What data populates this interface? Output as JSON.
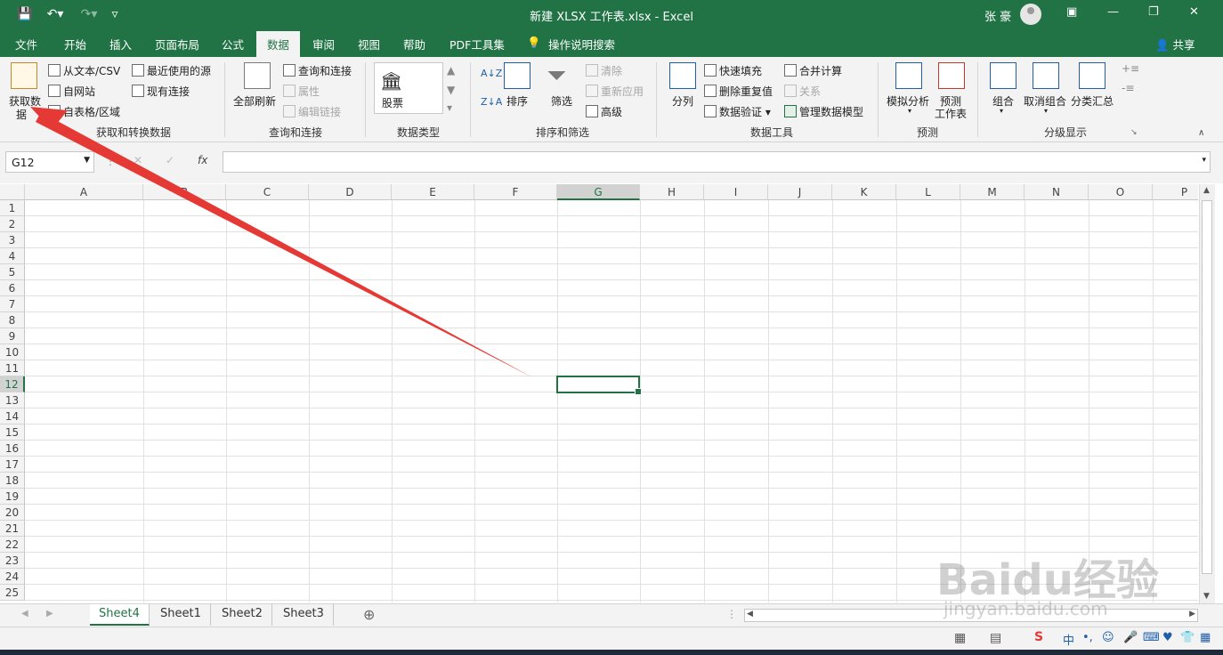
{
  "title": "新建 XLSX 工作表.xlsx  -  Excel",
  "user": "张 豪",
  "qat": {
    "save": "save-icon",
    "undo": "undo-icon",
    "redo": "redo-icon",
    "customize": "customize-icon"
  },
  "window": {
    "restore": "ribbon-display-icon",
    "minimize": "minimize-icon",
    "maximize": "maximize-icon",
    "close": "close-icon"
  },
  "tabs": [
    "文件",
    "开始",
    "插入",
    "页面布局",
    "公式",
    "数据",
    "审阅",
    "视图",
    "帮助",
    "PDF工具集",
    "操作说明搜索"
  ],
  "active_tab": "数据",
  "share": "共享",
  "ribbon": {
    "get_data": {
      "big": "获取数",
      "big2": "据",
      "from_text": "从文本/CSV",
      "from_web": "自网站",
      "from_table": "自表格/区域",
      "recent": "最近使用的源",
      "existing": "现有连接",
      "label": "获取和转换数据"
    },
    "queries": {
      "refresh": "全部刷新",
      "queries_conn": "查询和连接",
      "properties": "属性",
      "edit_links": "编辑链接",
      "label": "查询和连接"
    },
    "data_types": {
      "stock": "股票",
      "label": "数据类型"
    },
    "sort_filter": {
      "sort": "排序",
      "filter": "筛选",
      "clear": "清除",
      "reapply": "重新应用",
      "advanced": "高级",
      "label": "排序和筛选"
    },
    "data_tools": {
      "text_to_cols": "分列",
      "flash_fill": "快速填充",
      "remove_dup": "删除重复值",
      "validation": "数据验证",
      "consolidate": "合并计算",
      "relationships": "关系",
      "manage_model": "管理数据模型",
      "label": "数据工具"
    },
    "forecast": {
      "what_if": "模拟分析",
      "forecast_sheet": "预测",
      "forecast_sheet2": "工作表",
      "label": "预测"
    },
    "outline": {
      "group": "组合",
      "ungroup": "取消组合",
      "subtotal": "分类汇总",
      "label": "分级显示"
    }
  },
  "name_box": "G12",
  "fx": "fx",
  "columns": [
    "A",
    "B",
    "C",
    "D",
    "E",
    "F",
    "G",
    "H",
    "I",
    "J",
    "K",
    "L",
    "M",
    "N",
    "O",
    "P"
  ],
  "rows": [
    "1",
    "2",
    "3",
    "4",
    "5",
    "6",
    "7",
    "8",
    "9",
    "10",
    "11",
    "12",
    "13",
    "14",
    "15",
    "16",
    "17",
    "18",
    "19",
    "20",
    "21",
    "22",
    "23",
    "24",
    "25"
  ],
  "selected_cell": {
    "col": "G",
    "row": "12"
  },
  "sheets": [
    "Sheet4",
    "Sheet1",
    "Sheet2",
    "Sheet3"
  ],
  "active_sheet": "Sheet4",
  "watermark": {
    "brand": "Baidu经验",
    "url": "jingyan.baidu.com"
  },
  "annotation_color": "#e53935",
  "accent": "#217346"
}
